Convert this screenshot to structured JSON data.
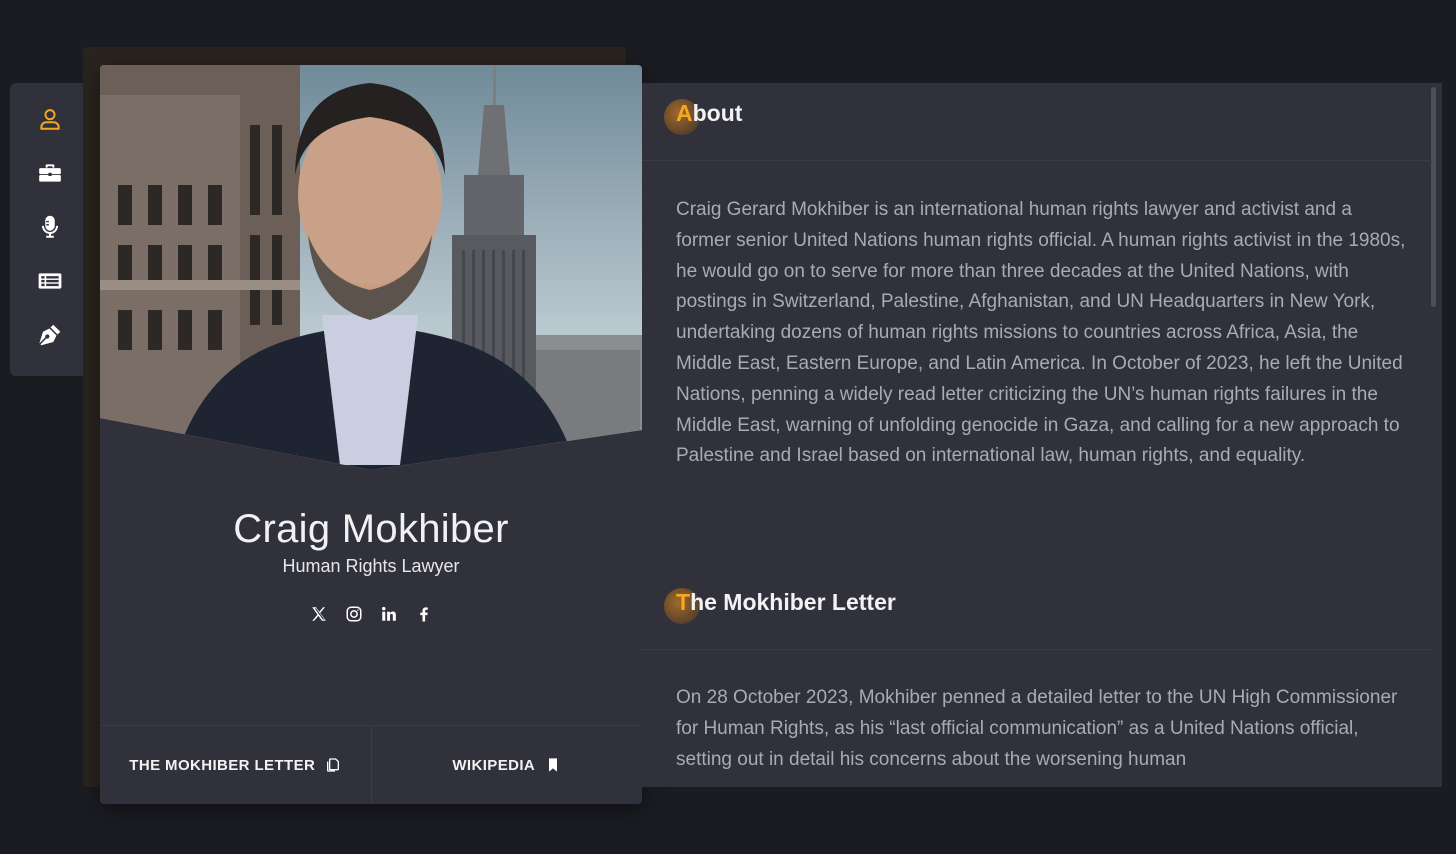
{
  "colors": {
    "accent": "#f5a623",
    "panel": "#30313b",
    "background": "#1b1c21"
  },
  "nav": {
    "items": [
      {
        "icon": "user-icon",
        "active": true
      },
      {
        "icon": "briefcase-icon",
        "active": false
      },
      {
        "icon": "microphone-icon",
        "active": false
      },
      {
        "icon": "newspaper-icon",
        "active": false
      },
      {
        "icon": "pen-nib-icon",
        "active": false
      }
    ]
  },
  "profile": {
    "name": "Craig Mokhiber",
    "role": "Human Rights Lawyer",
    "socials": [
      "x-icon",
      "instagram-icon",
      "linkedin-icon",
      "facebook-icon"
    ],
    "links": [
      {
        "label": "THE MOKHIBER LETTER",
        "icon": "document-copy-icon"
      },
      {
        "label": "WIKIPEDIA",
        "icon": "bookmark-icon"
      }
    ]
  },
  "about": {
    "title_first": "A",
    "title_rest": "bout",
    "body": "Craig Gerard Mokhiber is an international human rights lawyer and activist and a former senior United Nations human rights official. A human rights activist in the 1980s, he would go on to serve for more than three decades at the United Nations, with postings in Switzerland, Palestine, Afghanistan, and UN Headquarters in New York, undertaking dozens of human rights missions to countries across Africa, Asia, the Middle East, Eastern Europe, and Latin America. In October of 2023, he left the United Nations, penning a widely read letter criticizing the UN’s human rights failures in the Middle East, warning of unfolding genocide in Gaza, and calling for a new approach to Palestine and Israel based on international law, human rights, and equality."
  },
  "letter": {
    "title_first": "T",
    "title_rest": "he Mokhiber Letter",
    "body": "On 28 October 2023, Mokhiber penned a detailed letter to the UN High Commissioner for Human Rights, as his “last official communication” as a United Nations official,  setting out in detail his concerns about the worsening human"
  }
}
